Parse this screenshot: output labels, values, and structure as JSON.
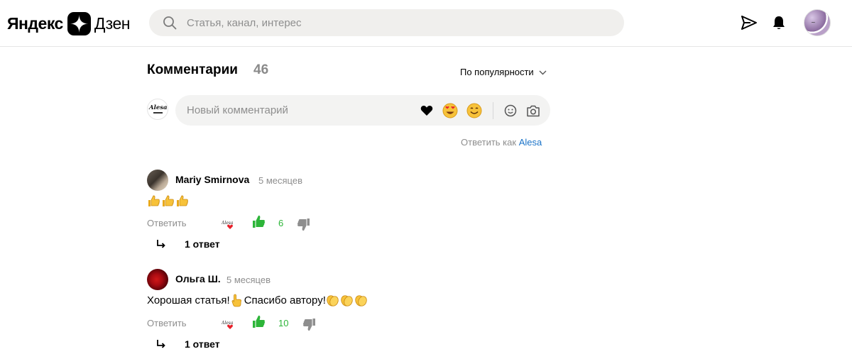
{
  "header": {
    "logo_word1": "Яндекс",
    "logo_word2": "Дзен",
    "search_placeholder": "Статья, канал, интерес"
  },
  "comments": {
    "title": "Комментарии",
    "count": "46",
    "sort_label": "По популярности",
    "new_comment_placeholder": "Новый комментарий",
    "reply_as_prefix": "Ответить как",
    "reply_as_name": "Alesa",
    "my_avatar_text": "Alesa",
    "items": [
      {
        "author": "Mariy Smirnova",
        "time": "5 месяцев",
        "text": "",
        "text_after": "",
        "emoji_sequence": [
          "thumbs-up",
          "thumbs-up",
          "thumbs-up"
        ],
        "reply_label": "Ответить",
        "likes": "6",
        "replies": "1 ответ"
      },
      {
        "author": "Ольга Ш.",
        "time": "5 месяцев",
        "text": "Хорошая статья!",
        "text_after": " Спасибо автору!",
        "emoji_sequence": [
          "pointing-hand",
          "clapping-hands",
          "clapping-hands",
          "clapping-hands"
        ],
        "reply_label": "Ответить",
        "likes": "10",
        "replies": "1 ответ"
      }
    ]
  },
  "colors": {
    "like_green": "#2db539",
    "link_blue": "#1a73c8",
    "muted_gray": "#8e8e8e",
    "search_bg": "#f0efed"
  }
}
